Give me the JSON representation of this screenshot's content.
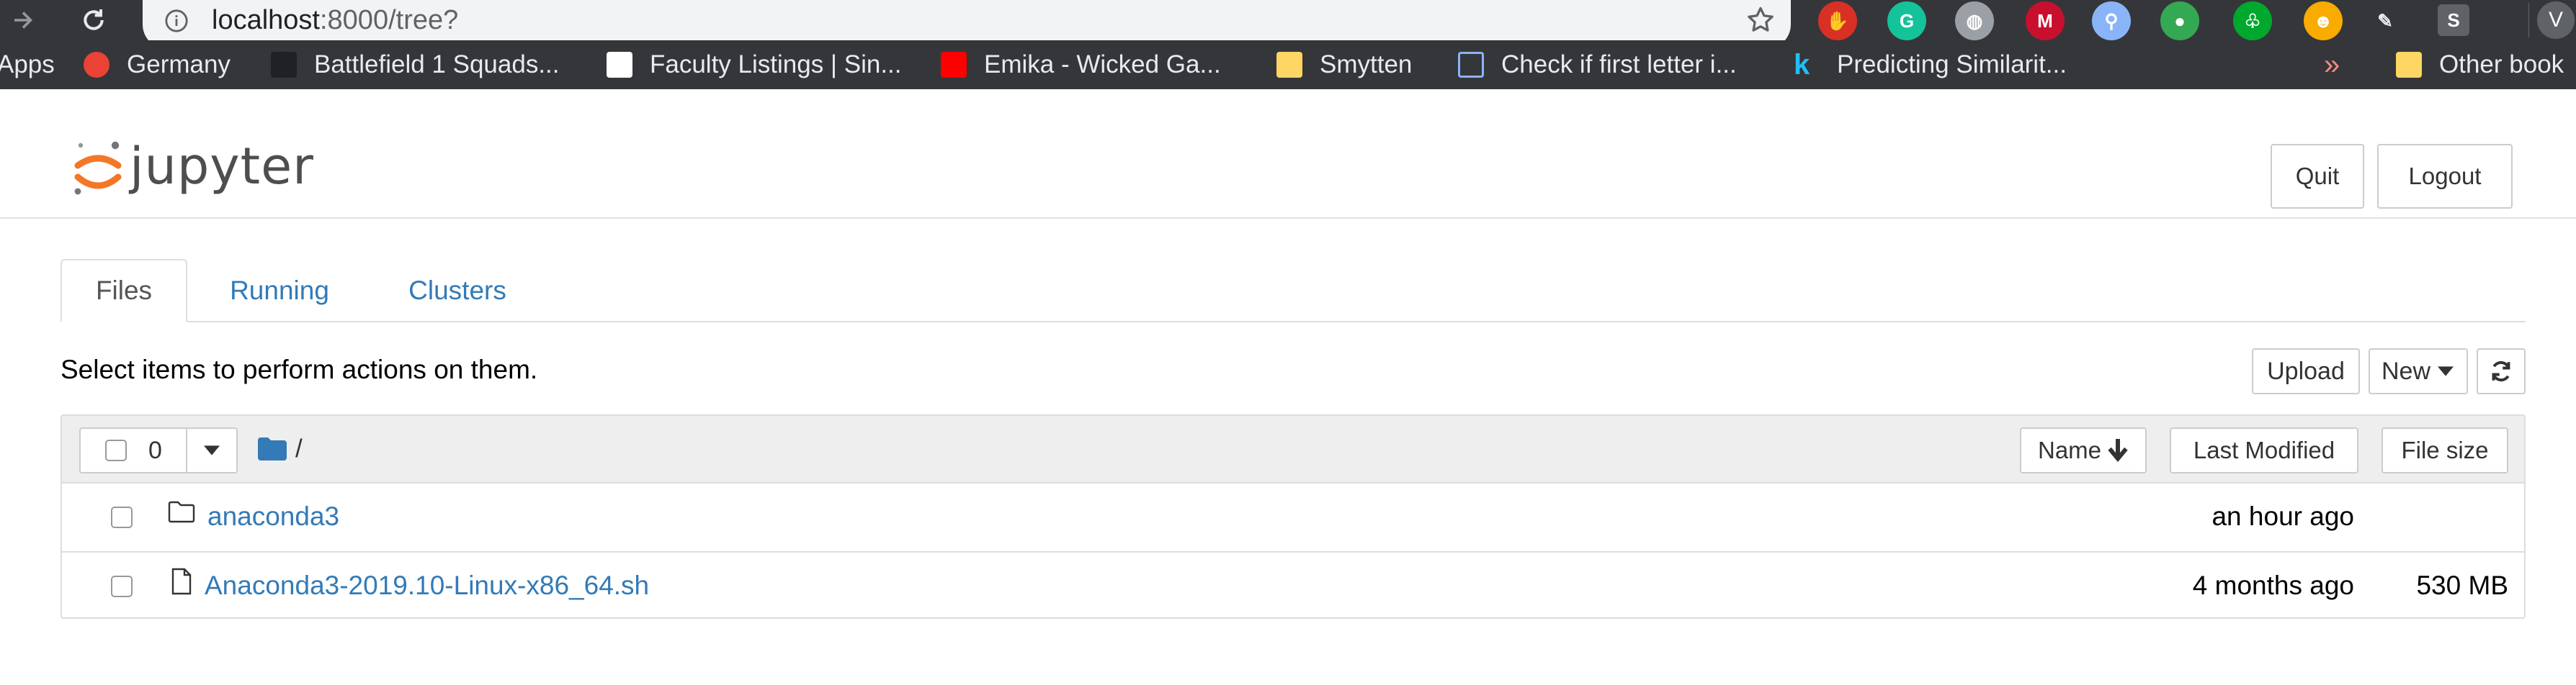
{
  "browser": {
    "url_host": "localhost",
    "url_path": ":8000/tree?",
    "extensions": [
      {
        "name": "adblock-icon",
        "color": "#d93025",
        "glyph": "✋"
      },
      {
        "name": "grammarly-icon",
        "color": "#15c39a",
        "glyph": "G"
      },
      {
        "name": "globe-icon",
        "color": "#9aa0a6",
        "glyph": "◍"
      },
      {
        "name": "mcafee-icon",
        "color": "#c8102e",
        "glyph": "M"
      },
      {
        "name": "search-person-icon",
        "color": "#8ab4f8",
        "glyph": "⚲"
      },
      {
        "name": "green-bubble-icon",
        "color": "#34a853",
        "glyph": "●"
      },
      {
        "name": "evernote-icon",
        "color": "#00a82d",
        "glyph": "♧"
      },
      {
        "name": "nerd-face-icon",
        "color": "#f9ab00",
        "glyph": "☻"
      },
      {
        "name": "pen-check-icon",
        "color": "#202124",
        "glyph": "✎"
      },
      {
        "name": "s-extension-icon",
        "color": "#5f6368",
        "glyph": "S"
      }
    ],
    "profile_initial": "V",
    "bookmarks": [
      {
        "label": "Apps",
        "fav": "apps",
        "color": "#e8eaed"
      },
      {
        "label": "Germany",
        "fav": "germany",
        "color": "#ea4335"
      },
      {
        "label": "Battlefield 1 Squads...",
        "fav": "battlefield",
        "color": "#202124"
      },
      {
        "label": "Faculty Listings | Sin...",
        "fav": "faculty",
        "color": "#ffffff"
      },
      {
        "label": "Emika - Wicked Ga...",
        "fav": "youtube",
        "color": "#ff0000"
      },
      {
        "label": "Smytten",
        "fav": "folder",
        "color": "#fdd663"
      },
      {
        "label": "Check if first letter i...",
        "fav": "brackets",
        "color": "#8ab4f8"
      },
      {
        "label": "Predicting Similarit...",
        "fav": "kaggle",
        "color": "#20beff"
      }
    ],
    "overflow_glyph": "»",
    "other_bookmarks": "Other book"
  },
  "jupyter": {
    "logo_text": "jupyter",
    "quit_label": "Quit",
    "logout_label": "Logout",
    "tabs": [
      "Files",
      "Running",
      "Clusters"
    ],
    "select_message": "Select items to perform actions on them.",
    "upload_label": "Upload",
    "new_label": "New",
    "selected_count": "0",
    "breadcrumb_path": "/",
    "sort_name_label": "Name",
    "last_modified_label": "Last Modified",
    "file_size_label": "File size",
    "files": [
      {
        "name": "anaconda3",
        "type": "folder",
        "modified": "an hour ago",
        "size": ""
      },
      {
        "name": "Anaconda3-2019.10-Linux-x86_64.sh",
        "type": "file",
        "modified": "4 months ago",
        "size": "530 MB"
      }
    ]
  },
  "colors": {
    "link": "#337ab7",
    "jupyter_orange": "#f37726",
    "chrome_dark": "#35363a"
  }
}
